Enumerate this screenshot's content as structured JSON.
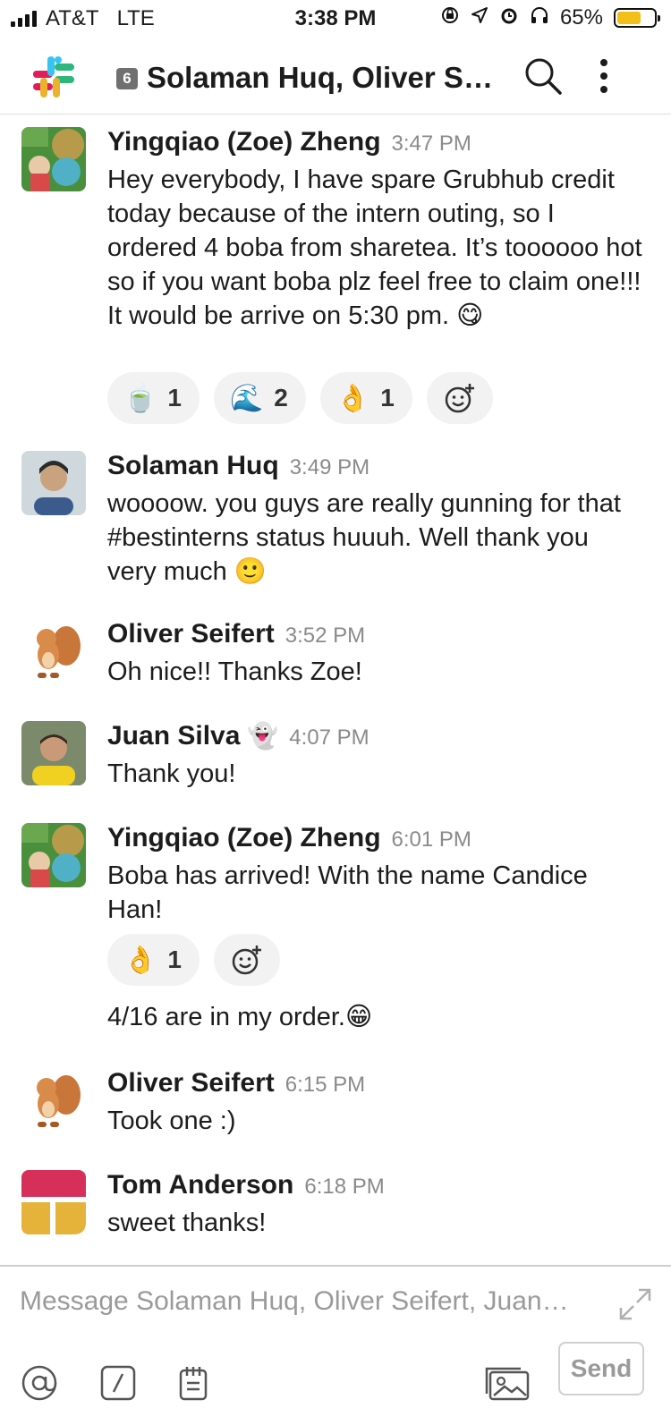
{
  "status_bar": {
    "carrier": "AT&T",
    "network": "LTE",
    "time": "3:38 PM",
    "battery_percent": "65%",
    "battery_level": 0.65,
    "battery_color": "#f3c018"
  },
  "header": {
    "member_count": "6",
    "title": "Solaman Huq, Oliver Sei…",
    "logo": "slack-logo",
    "search_icon": "search-icon",
    "more_icon": "more-vertical-icon"
  },
  "messages": [
    {
      "author": "Yingqiao (Zoe) Zheng",
      "time": "3:47 PM",
      "text": "Hey everybody, I have spare Grubhub credit today because of the intern outing, so I ordered 4 boba from sharetea. It’s toooooo hot so if you want boba plz feel free to claim one!!! It would be arrive on 5:30 pm. 😋",
      "reactions": [
        {
          "emoji": "🍵",
          "count": "1"
        },
        {
          "emoji": "🌊",
          "count": "2"
        },
        {
          "emoji": "👌",
          "count": "1"
        }
      ]
    },
    {
      "author": "Solaman Huq",
      "time": "3:49 PM",
      "text": "woooow. you guys are really gunning for that #bestinterns status huuuh. Well thank you very much 🙂"
    },
    {
      "author": "Oliver Seifert",
      "time": "3:52 PM",
      "text": "Oh nice!! Thanks Zoe!"
    },
    {
      "author": "Juan Silva",
      "status_emoji": "👻",
      "time": "4:07 PM",
      "text": "Thank you!"
    },
    {
      "author": "Yingqiao (Zoe) Zheng",
      "time": "6:01 PM",
      "text": "Boba has arrived! With the name Candice Han!",
      "reactions": [
        {
          "emoji": "👌",
          "count": "1"
        }
      ],
      "followup": "4/16 are in my order.😁"
    },
    {
      "author": "Oliver Seifert",
      "time": "6:15 PM",
      "text": "Took one :)"
    },
    {
      "author": "Tom Anderson",
      "time": "6:18 PM",
      "text": "sweet thanks!"
    }
  ],
  "composer": {
    "placeholder": "Message Solaman Huq, Oliver Seifert, Juan…",
    "send_label": "Send"
  }
}
